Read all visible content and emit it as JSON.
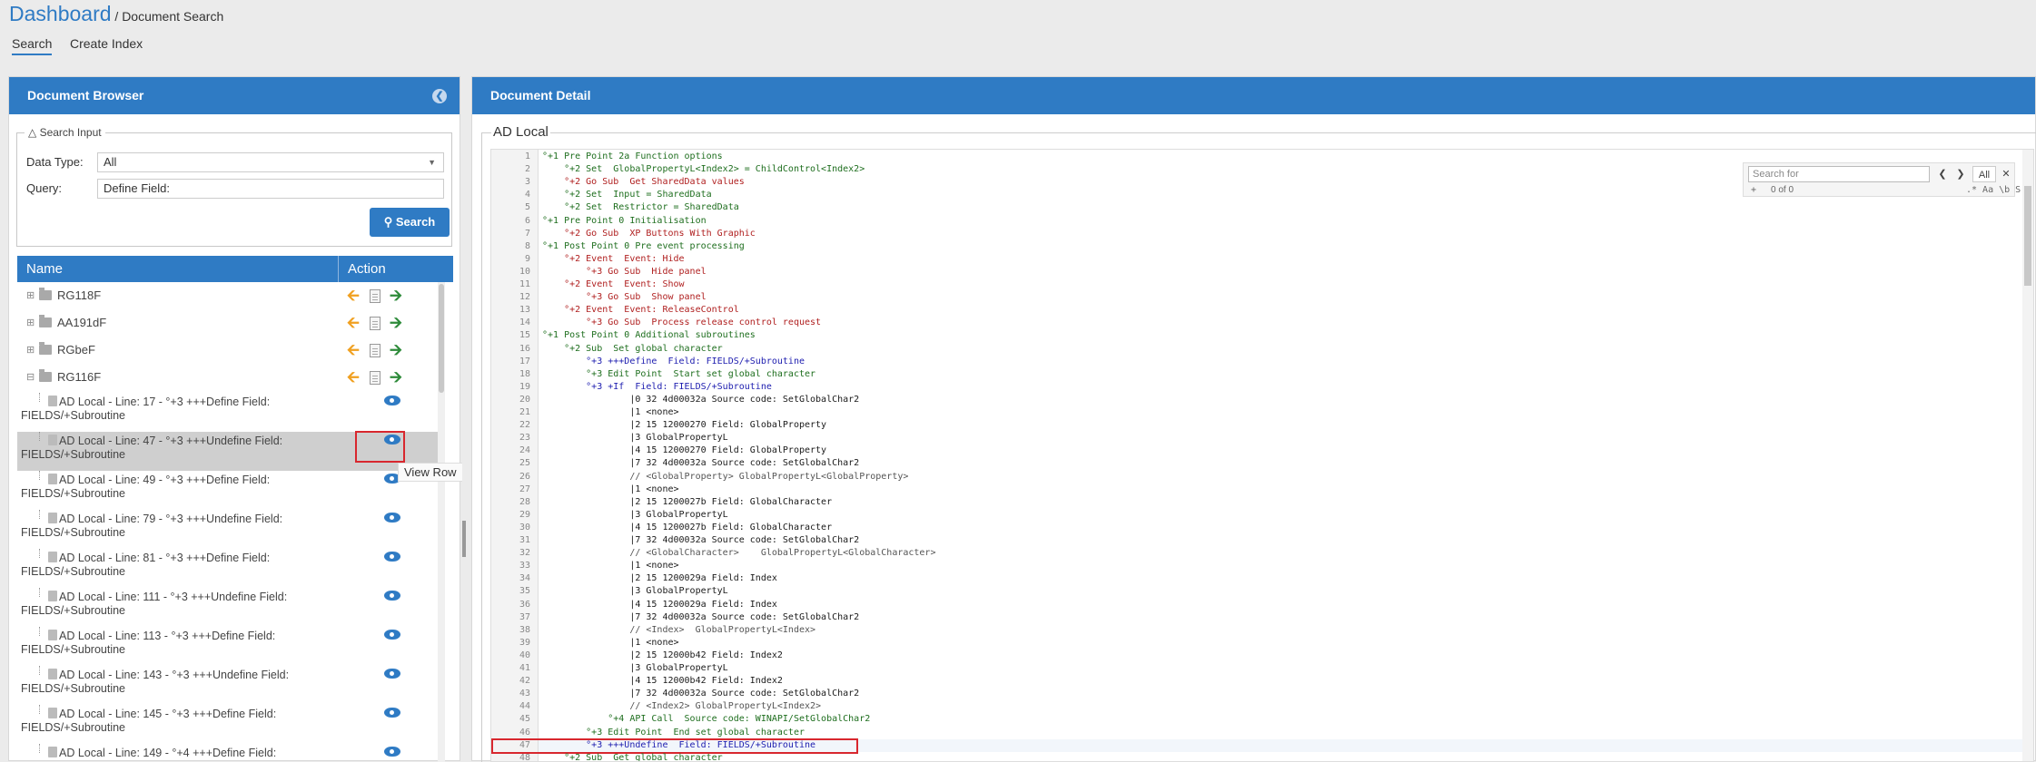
{
  "breadcrumb": {
    "dashboard": "Dashboard",
    "current": " / Document Search"
  },
  "tabs": [
    {
      "label": "Search"
    },
    {
      "label": "Create Index"
    }
  ],
  "left_panel": {
    "title": "Document Browser",
    "collapse_icon": "chevron-left-icon",
    "search_input": {
      "legend": "Search Input",
      "data_type_label": "Data Type:",
      "data_type_value": "All",
      "query_label": "Query:",
      "query_value": "Define  Field:",
      "search_button": "Search"
    },
    "table": {
      "col_name": "Name",
      "col_action": "Action",
      "folders": [
        {
          "name": "RG118F"
        },
        {
          "name": "AA191dF"
        },
        {
          "name": "RGbeF"
        },
        {
          "name": "RG116F"
        }
      ],
      "rows": [
        {
          "text": "AD Local - Line: 17 - °+3 +++Define Field: FIELDS/+Subroutine"
        },
        {
          "text": "AD Local - Line: 47 - °+3 +++Undefine Field: FIELDS/+Subroutine"
        },
        {
          "text": "AD Local - Line: 49 - °+3 +++Define Field: FIELDS/+Subroutine"
        },
        {
          "text": "AD Local - Line: 79 - °+3 +++Undefine Field: FIELDS/+Subroutine"
        },
        {
          "text": "AD Local - Line: 81 - °+3 +++Define Field: FIELDS/+Subroutine"
        },
        {
          "text": "AD Local - Line: 111 - °+3 +++Undefine Field: FIELDS/+Subroutine"
        },
        {
          "text": "AD Local - Line: 113 - °+3 +++Define Field: FIELDS/+Subroutine"
        },
        {
          "text": "AD Local - Line: 143 - °+3 +++Undefine Field: FIELDS/+Subroutine"
        },
        {
          "text": "AD Local - Line: 145 - °+3 +++Define Field: FIELDS/+Subroutine"
        },
        {
          "text": "AD Local - Line: 149 - °+4 +++Define Field:"
        }
      ],
      "tooltip": "View Row"
    }
  },
  "right_panel": {
    "title": "Document Detail",
    "doc_title": "AD Local",
    "find": {
      "placeholder": "Search for",
      "all": "All",
      "count": "0 of 0",
      "plus": "+",
      "options": ".* Aa \\b S"
    },
    "code_lines": [
      {
        "n": "1",
        "t": "°+1 Pre Point 2a Function options"
      },
      {
        "n": "2",
        "t": "    °+2 Set  GlobalPropertyL<Index2> = ChildControl<Index2>"
      },
      {
        "n": "3",
        "t": "    °+2 Go Sub  Get SharedData values"
      },
      {
        "n": "4",
        "t": "    °+2 Set  Input = SharedData"
      },
      {
        "n": "5",
        "t": "    °+2 Set  Restrictor = SharedData"
      },
      {
        "n": "6",
        "t": "°+1 Pre Point 0 Initialisation"
      },
      {
        "n": "7",
        "t": "    °+2 Go Sub  XP Buttons With Graphic"
      },
      {
        "n": "8",
        "t": "°+1 Post Point 0 Pre event processing"
      },
      {
        "n": "9",
        "t": "    °+2 Event  Event: Hide"
      },
      {
        "n": "10",
        "t": "        °+3 Go Sub  Hide panel"
      },
      {
        "n": "11",
        "t": "    °+2 Event  Event: Show"
      },
      {
        "n": "12",
        "t": "        °+3 Go Sub  Show panel"
      },
      {
        "n": "13",
        "t": "    °+2 Event  Event: ReleaseControl"
      },
      {
        "n": "14",
        "t": "        °+3 Go Sub  Process release control request"
      },
      {
        "n": "15",
        "t": "°+1 Post Point 0 Additional subroutines"
      },
      {
        "n": "16",
        "t": "    °+2 Sub  Set global character"
      },
      {
        "n": "17",
        "t": "        °+3 +++Define  Field: FIELDS/+Subroutine"
      },
      {
        "n": "18",
        "t": "        °+3 Edit Point  Start set global character"
      },
      {
        "n": "19",
        "t": "        °+3 +If  Field: FIELDS/+Subroutine"
      },
      {
        "n": "20",
        "t": "                |0 32 4d00032a Source code: SetGlobalChar2"
      },
      {
        "n": "21",
        "t": "                |1 <none>"
      },
      {
        "n": "22",
        "t": "                |2 15 12000270 Field: GlobalProperty"
      },
      {
        "n": "23",
        "t": "                |3 GlobalPropertyL"
      },
      {
        "n": "24",
        "t": "                |4 15 12000270 Field: GlobalProperty"
      },
      {
        "n": "25",
        "t": "                |7 32 4d00032a Source code: SetGlobalChar2"
      },
      {
        "n": "26",
        "t": "                // <GlobalProperty> GlobalPropertyL<GlobalProperty>"
      },
      {
        "n": "27",
        "t": "                |1 <none>"
      },
      {
        "n": "28",
        "t": "                |2 15 1200027b Field: GlobalCharacter"
      },
      {
        "n": "29",
        "t": "                |3 GlobalPropertyL"
      },
      {
        "n": "30",
        "t": "                |4 15 1200027b Field: GlobalCharacter"
      },
      {
        "n": "31",
        "t": "                |7 32 4d00032a Source code: SetGlobalChar2"
      },
      {
        "n": "32",
        "t": "                // <GlobalCharacter>    GlobalPropertyL<GlobalCharacter>"
      },
      {
        "n": "33",
        "t": "                |1 <none>"
      },
      {
        "n": "34",
        "t": "                |2 15 1200029a Field: Index"
      },
      {
        "n": "35",
        "t": "                |3 GlobalPropertyL"
      },
      {
        "n": "36",
        "t": "                |4 15 1200029a Field: Index"
      },
      {
        "n": "37",
        "t": "                |7 32 4d00032a Source code: SetGlobalChar2"
      },
      {
        "n": "38",
        "t": "                // <Index>  GlobalPropertyL<Index>"
      },
      {
        "n": "39",
        "t": "                |1 <none>"
      },
      {
        "n": "40",
        "t": "                |2 15 12000b42 Field: Index2"
      },
      {
        "n": "41",
        "t": "                |3 GlobalPropertyL"
      },
      {
        "n": "42",
        "t": "                |4 15 12000b42 Field: Index2"
      },
      {
        "n": "43",
        "t": "                |7 32 4d00032a Source code: SetGlobalChar2"
      },
      {
        "n": "44",
        "t": "                // <Index2> GlobalPropertyL<Index2>"
      },
      {
        "n": "45",
        "t": "            °+4 API Call  Source code: WINAPI/SetGlobalChar2"
      },
      {
        "n": "46",
        "t": "        °+3 Edit Point  End set global character"
      },
      {
        "n": "47",
        "t": "        °+3 +++Undefine  Field: FIELDS/+Subroutine"
      },
      {
        "n": "48",
        "t": "    °+2 Sub  Get global character"
      }
    ]
  },
  "colors": {
    "accent": "#2f7bc4",
    "highlight": "#d8272e",
    "orange": "#f0a020",
    "green": "#2e8b3a"
  }
}
